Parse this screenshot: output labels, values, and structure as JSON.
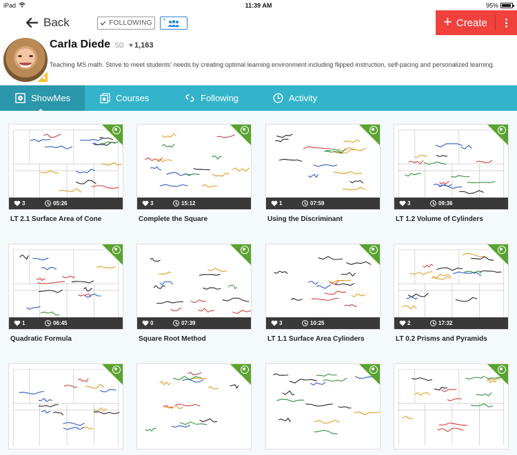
{
  "status_bar": {
    "device": "iPad",
    "time": "11:39 AM",
    "battery": "95%",
    "battery_level": 0.95
  },
  "header": {
    "back_label": "Back",
    "following_label": "FOLLOWING",
    "create_label": "Create",
    "colors": {
      "create": "#f1413d",
      "group_button": "#2a83d9"
    }
  },
  "profile": {
    "name": "Carla Diede",
    "badge": "SD",
    "likes": "1,163",
    "bio": "Teaching MS math. Strive to meet students' needs by creating optimal learning environment including flipped instruction, self-pacing and personalized learning."
  },
  "tabs": [
    {
      "label": "ShowMes",
      "icon": "play-square-icon",
      "active": true
    },
    {
      "label": "Courses",
      "icon": "stacked-videos-icon",
      "active": false
    },
    {
      "label": "Following",
      "icon": "link-icon",
      "active": false
    },
    {
      "label": "Activity",
      "icon": "clock-icon",
      "active": false
    }
  ],
  "tab_colors": {
    "bar": "#33b4ca",
    "active": "#2a97ab"
  },
  "showmes": [
    {
      "title": "LT 2.1 Surface Area of Cone",
      "likes": "3",
      "duration": "05:26",
      "public": true
    },
    {
      "title": "Complete the Square",
      "likes": "3",
      "duration": "15:12",
      "public": true
    },
    {
      "title": "Using the Discriminant",
      "likes": "1",
      "duration": "07:59",
      "public": true
    },
    {
      "title": "LT 1.2 Volume of Cylinders",
      "likes": "3",
      "duration": "09:36",
      "public": true
    },
    {
      "title": "Quadratic Formula",
      "likes": "1",
      "duration": "06:45",
      "public": true
    },
    {
      "title": "Square Root Method",
      "likes": "0",
      "duration": "07:39",
      "public": true
    },
    {
      "title": "LT 1.1 Surface Area Cylinders",
      "likes": "3",
      "duration": "10:25",
      "public": true
    },
    {
      "title": "LT 0.2 Prisms and Pyramids",
      "likes": "2",
      "duration": "17:32",
      "public": true
    },
    {
      "title": "",
      "likes": "",
      "duration": "",
      "public": true
    },
    {
      "title": "",
      "likes": "",
      "duration": "",
      "public": true
    },
    {
      "title": "",
      "likes": "",
      "duration": "",
      "public": true
    },
    {
      "title": "",
      "likes": "",
      "duration": "",
      "public": true
    }
  ]
}
